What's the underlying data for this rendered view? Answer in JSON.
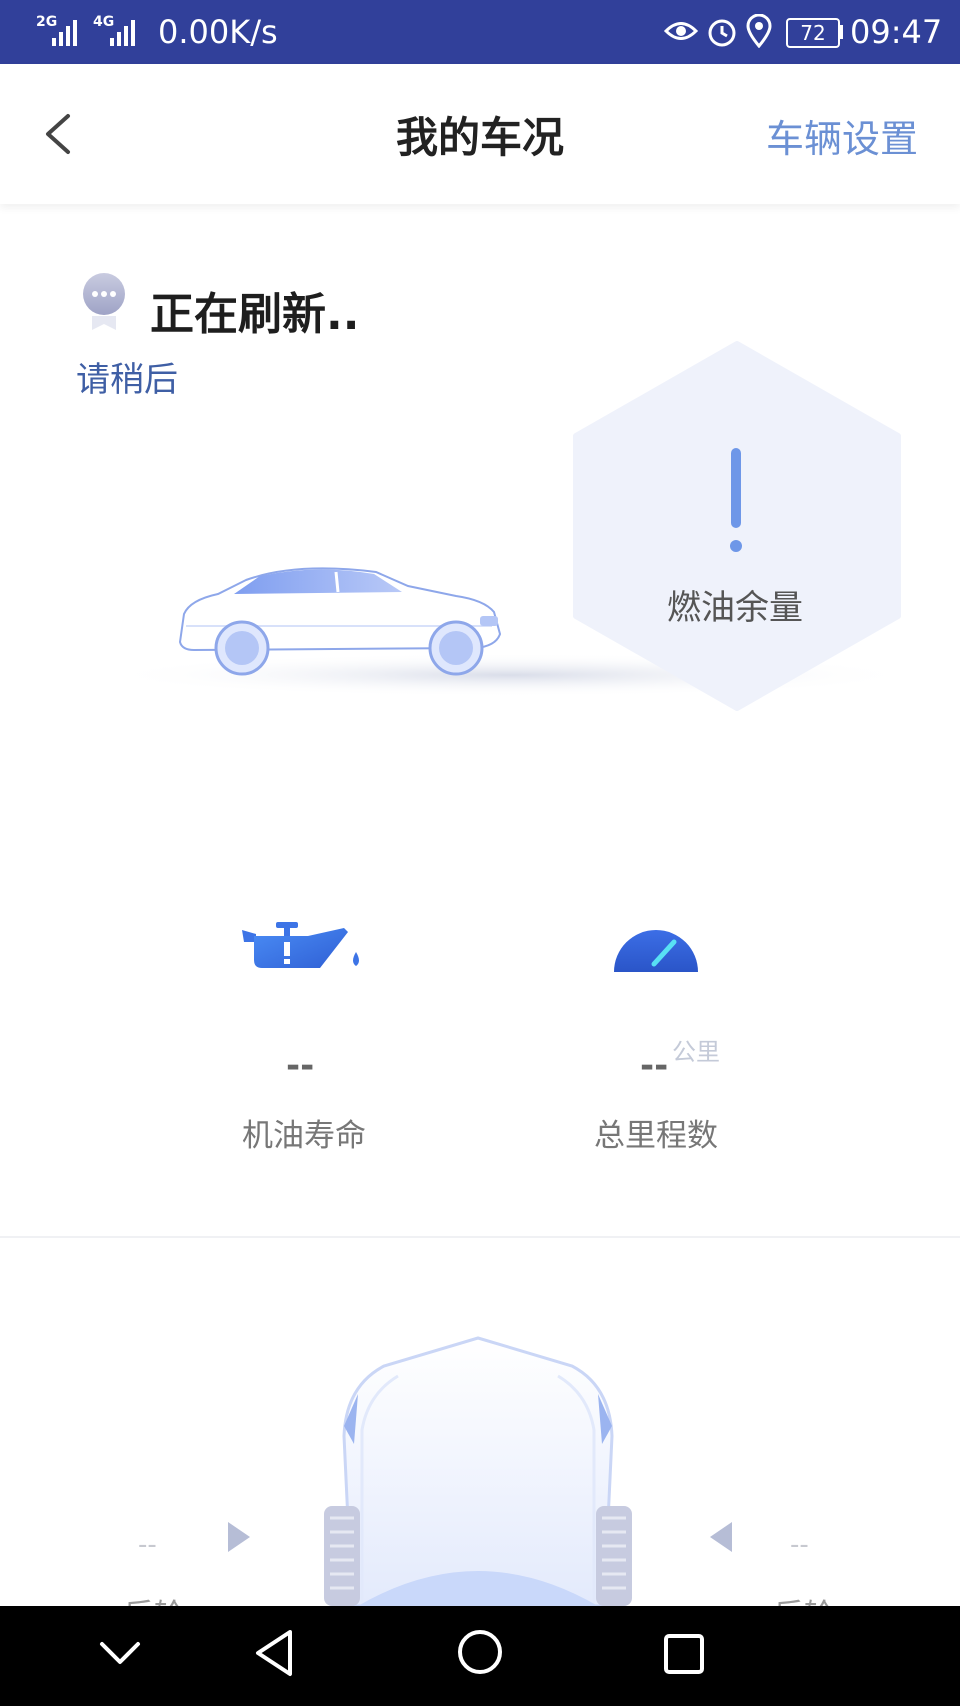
{
  "status_bar": {
    "network_2g": "2G",
    "network_4g": "4G",
    "speed": "0.00K/s",
    "battery": "72",
    "time": "09:47"
  },
  "header": {
    "title": "我的车况",
    "settings_label": "车辆设置"
  },
  "refresh": {
    "title": "正在刷新..",
    "subtitle": "请稍后"
  },
  "fuel": {
    "label": "燃油余量"
  },
  "stats": {
    "oil_life": {
      "value": "--",
      "label": "机油寿命"
    },
    "mileage": {
      "value": "--",
      "unit": "公里",
      "label": "总里程数"
    }
  },
  "tires": {
    "left_value": "--",
    "right_value": "--",
    "left_label": "后轮",
    "right_label": "后轮"
  },
  "colors": {
    "status_bar": "#31409a",
    "accent": "#6b90d4",
    "icon_blue": "#3b73e6"
  }
}
